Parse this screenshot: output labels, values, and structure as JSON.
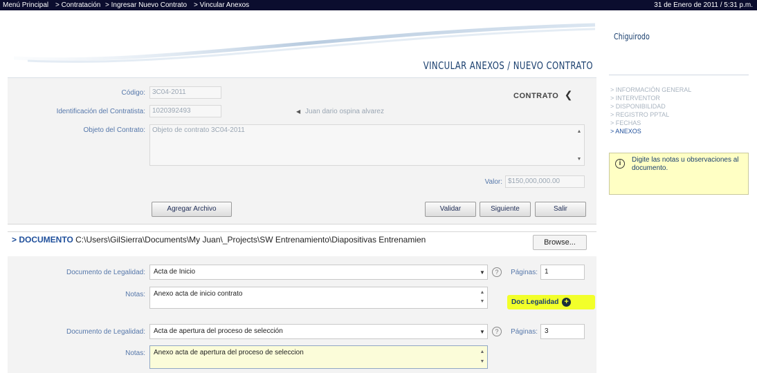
{
  "topbar": {
    "crumbs": [
      "Menú Principal",
      "> Contratación",
      "> Ingresar Nuevo Contrato",
      "> Vincular Anexos"
    ],
    "date": "31 de Enero de 2011 / 5:31 p.m."
  },
  "page": {
    "title": "VINCULAR ANEXOS / NUEVO CONTRATO"
  },
  "contract": {
    "tag": "CONTRATO",
    "codigo_label": "Código:",
    "codigo_value": "3C04-2011",
    "ident_label": "Identificación del Contratista:",
    "ident_value": "1020392493",
    "contratista_name": "Juan dario ospina alvarez",
    "objeto_label": "Objeto del Contrato:",
    "objeto_value": "Objeto de contrato 3C04-2011",
    "valor_label": "Valor:",
    "valor_value": "$150,000,000.00"
  },
  "buttons": {
    "agregar": "Agregar Archivo",
    "validar": "Validar",
    "siguiente": "Siguiente",
    "salir": "Salir",
    "browse": "Browse..."
  },
  "sidebar": {
    "user": "Chiguirodo",
    "nav": [
      "> INFORMACIÓN GENERAL",
      "> INTERVENTOR",
      "> DISPONIBILIDAD",
      "> REGISTRO PPTAL",
      "> FECHAS",
      "> ANEXOS"
    ],
    "info": "Digite las notas u observaciones al documento."
  },
  "documento": {
    "heading": "> DOCUMENTO",
    "path": "C:\\Users\\GilSierra\\Documents\\My Juan\\_Projects\\SW Entrenamiento\\Diapositivas Entrenamien",
    "legalidad_label": "Documento de Legalidad:",
    "notas_label": "Notas:",
    "paginas_label": "Páginas:",
    "help_glyph": "?",
    "doc_legalidad_button": "Doc Legalidad",
    "entries": [
      {
        "tipo": "Acta de Inicio",
        "paginas": "1",
        "notas": "Anexo acta de inicio contrato"
      },
      {
        "tipo": "Acta de apertura del proceso de selección",
        "paginas": "3",
        "notas": "Anexo acta de apertura del proceso de seleccion"
      }
    ]
  }
}
